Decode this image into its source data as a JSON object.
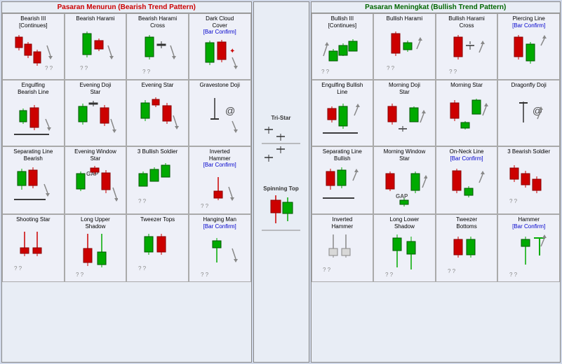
{
  "bearish_header": "Pasaran Menurun (Bearish Trend Pattern)",
  "bullish_header": "Pasaran Meningkat (Bullish Trend Pattern)",
  "bearish_patterns": [
    {
      "name": "Bearish III [Continues]",
      "row": 0,
      "col": 0,
      "type": "bearish3"
    },
    {
      "name": "Bearish Harami",
      "row": 0,
      "col": 1,
      "type": "bearishharami"
    },
    {
      "name": "Bearish Harami Cross",
      "row": 0,
      "col": 2,
      "type": "bearishharamicross"
    },
    {
      "name": "Dark Cloud Cover",
      "confirm": true,
      "row": 0,
      "col": 3,
      "type": "darkcloud"
    },
    {
      "name": "Engulfing Bearish Line",
      "row": 1,
      "col": 0,
      "type": "engulfingbearish"
    },
    {
      "name": "Evening Doji Star",
      "row": 1,
      "col": 1,
      "type": "eveningdoji"
    },
    {
      "name": "Evening Star",
      "row": 1,
      "col": 2,
      "type": "eveningstar"
    },
    {
      "name": "Gravestone Doji",
      "row": 1,
      "col": 3,
      "type": "gravestonedoji"
    },
    {
      "name": "Separating Line Bearish",
      "row": 2,
      "col": 0,
      "type": "separatingbearish"
    },
    {
      "name": "Evening Window Star",
      "row": 2,
      "col": 1,
      "type": "eveningwindow"
    },
    {
      "name": "3 Bullish Soldier",
      "row": 2,
      "col": 2,
      "type": "3bullishsoldier"
    },
    {
      "name": "Inverted Hammer",
      "confirm": true,
      "row": 2,
      "col": 3,
      "type": "invertedhammer"
    },
    {
      "name": "Shooting Star",
      "row": 3,
      "col": 0,
      "type": "shootingstar"
    },
    {
      "name": "Long Upper Shadow",
      "row": 3,
      "col": 1,
      "type": "longuppershadow"
    },
    {
      "name": "Tweezer Tops",
      "row": 3,
      "col": 2,
      "type": "tweezertops"
    },
    {
      "name": "Hanging Man",
      "confirm": true,
      "row": 3,
      "col": 3,
      "type": "hangingman"
    }
  ],
  "bullish_patterns": [
    {
      "name": "Bullish III [Continues]",
      "row": 0,
      "col": 0,
      "type": "bullish3"
    },
    {
      "name": "Bullish Harami",
      "row": 0,
      "col": 1,
      "type": "bullishharami"
    },
    {
      "name": "Bullish Harami Cross",
      "row": 0,
      "col": 2,
      "type": "bullishharamicross"
    },
    {
      "name": "Piercing Line",
      "confirm": true,
      "row": 0,
      "col": 3,
      "type": "piercingline"
    },
    {
      "name": "Engulfing Bullish Line",
      "row": 1,
      "col": 0,
      "type": "engulfingbullish"
    },
    {
      "name": "Morning Doji Star",
      "row": 1,
      "col": 1,
      "type": "morningdoji"
    },
    {
      "name": "Morning Star",
      "row": 1,
      "col": 2,
      "type": "morningstar"
    },
    {
      "name": "Dragonfly Doji",
      "row": 1,
      "col": 3,
      "type": "dragonflydoji"
    },
    {
      "name": "Separating Line Bullish",
      "row": 2,
      "col": 0,
      "type": "separatingbullish"
    },
    {
      "name": "Morning Window Star",
      "row": 2,
      "col": 1,
      "type": "morningwindow"
    },
    {
      "name": "On-Neck Line",
      "confirm": true,
      "row": 2,
      "col": 2,
      "type": "onneck"
    },
    {
      "name": "3 Bearish Soldier",
      "row": 2,
      "col": 3,
      "type": "3bearishsoldier"
    },
    {
      "name": "Inverted Hammer",
      "row": 3,
      "col": 0,
      "type": "invertedhammerbullish"
    },
    {
      "name": "Long Lower Shadow",
      "row": 3,
      "col": 1,
      "type": "longlowershadow"
    },
    {
      "name": "Tweezer Bottoms",
      "row": 3,
      "col": 2,
      "type": "tweezerbottoms"
    },
    {
      "name": "Hammer",
      "confirm": true,
      "row": 3,
      "col": 3,
      "type": "hammer"
    }
  ],
  "middle_patterns": [
    {
      "name": "Tri-Star",
      "type": "tristar"
    },
    {
      "name": "Spinning Top",
      "type": "spinningtop"
    }
  ]
}
